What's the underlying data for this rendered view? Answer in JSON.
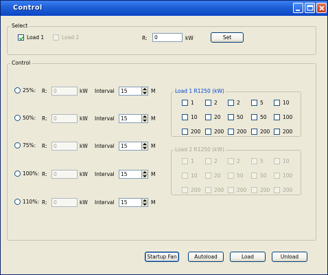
{
  "window": {
    "title": "Control"
  },
  "select": {
    "label": "Select",
    "load1": {
      "label": "Load 1",
      "checked": true
    },
    "load2": {
      "label": "Load 2",
      "checked": false,
      "disabled": true
    },
    "r_label": "R:",
    "r_value": "0",
    "unit": "kW",
    "set_button": "Set"
  },
  "control": {
    "label": "Control",
    "rows": [
      {
        "pct": "25%:",
        "r_label": "R:",
        "r_value": "0",
        "unit": "kW",
        "interval_label": "Interval",
        "interval": "15",
        "spin_unit": "M"
      },
      {
        "pct": "50%:",
        "r_label": "R:",
        "r_value": "0",
        "unit": "kW",
        "interval_label": "Interval",
        "interval": "15",
        "spin_unit": "M"
      },
      {
        "pct": "75%:",
        "r_label": "R:",
        "r_value": "0",
        "unit": "kW",
        "interval_label": "Interval",
        "interval": "15",
        "spin_unit": "M"
      },
      {
        "pct": "100%:",
        "r_label": "R:",
        "r_value": "0",
        "unit": "kW",
        "interval_label": "Interval",
        "interval": "15",
        "spin_unit": "M"
      },
      {
        "pct": "110%:",
        "r_label": "R:",
        "r_value": "0",
        "unit": "kW",
        "interval_label": "Interval",
        "interval": "15",
        "spin_unit": "M"
      }
    ]
  },
  "load1_group": {
    "label": "Load 1 R1250 (kW)",
    "rows": [
      [
        "1",
        "2",
        "2",
        "5",
        "10"
      ],
      [
        "10",
        "20",
        "50",
        "50",
        "100"
      ],
      [
        "200",
        "200",
        "200",
        "200",
        "200"
      ]
    ]
  },
  "load2_group": {
    "label": "Load 2 R1250 (kW)",
    "rows": [
      [
        "1",
        "2",
        "2",
        "5",
        "10"
      ],
      [
        "10",
        "20",
        "50",
        "50",
        "100"
      ],
      [
        "200",
        "200",
        "200",
        "200",
        "200"
      ]
    ]
  },
  "buttons": {
    "startup_fan": "Startup Fan",
    "autoload": "Autoload",
    "load": "Load",
    "unload": "Unload"
  },
  "colors": {
    "titlebar": "#0a46c4",
    "face": "#ece9d8",
    "group_label_blue": "#0046d5"
  }
}
